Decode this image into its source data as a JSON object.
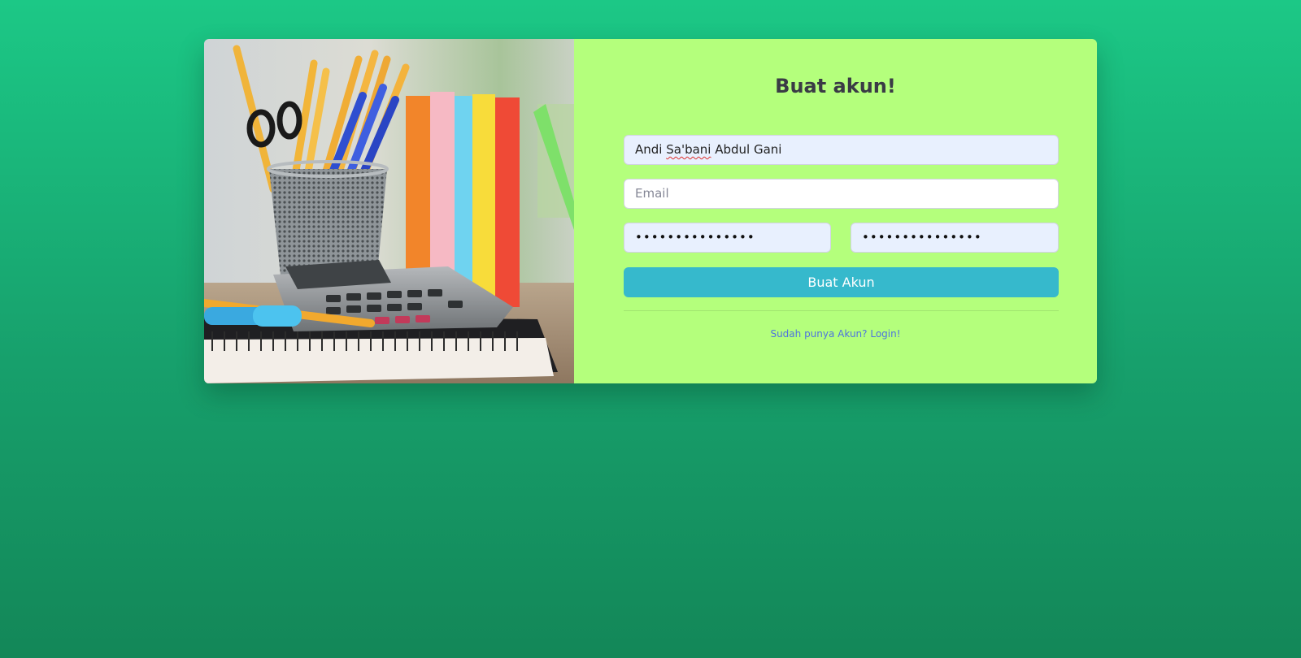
{
  "register": {
    "title": "Buat akun!",
    "name_value_part1": "Andi ",
    "name_value_part2": "Sa'bani",
    "name_value_part3": " Abdul Gani",
    "email_placeholder": "Email",
    "password_mask": "•••••••••••••••",
    "repeat_password_mask": "•••••••••••••••",
    "submit_label": "Buat Akun",
    "login_link": "Sudah punya Akun? Login!"
  },
  "colors": {
    "background": "#1cc886",
    "form_panel": "#b4ff7c",
    "button": "#36b9cc",
    "link": "#4e73df",
    "filled_input": "#e8f0fe"
  },
  "image": {
    "subject": "school-supplies-photo"
  }
}
